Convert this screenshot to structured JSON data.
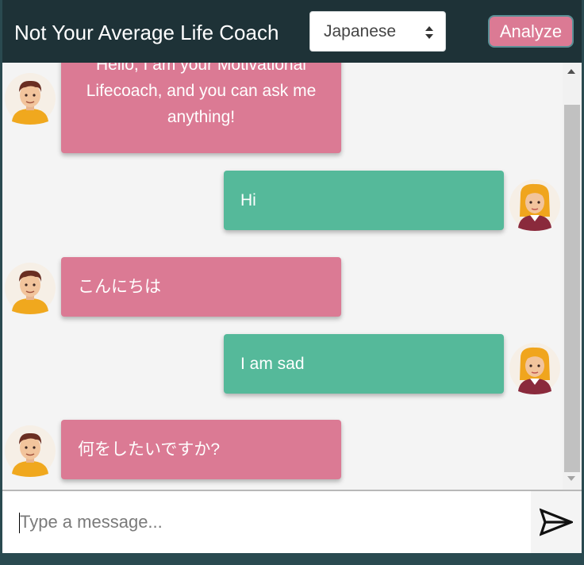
{
  "header": {
    "title": "Not Your Average Life Coach",
    "language_select": {
      "selected": "Japanese"
    },
    "analyze_label": "Analyze"
  },
  "messages": [
    {
      "sender": "bot",
      "text": "Hello, I am your Motivational Lifecoach, and you can ask me anything!"
    },
    {
      "sender": "user",
      "text": "Hi"
    },
    {
      "sender": "bot",
      "text": "こんにちは"
    },
    {
      "sender": "user",
      "text": "I am sad"
    },
    {
      "sender": "bot",
      "text": "何をしたいですか?"
    }
  ],
  "composer": {
    "placeholder": "Type a message..."
  },
  "colors": {
    "header_bg": "#1e3237",
    "bot_bubble": "#db7a94",
    "user_bubble": "#55b99a",
    "analyze_button": "#db7a94"
  },
  "icons": {
    "send": "send-icon",
    "bot_avatar": "male-avatar",
    "user_avatar": "female-avatar"
  }
}
